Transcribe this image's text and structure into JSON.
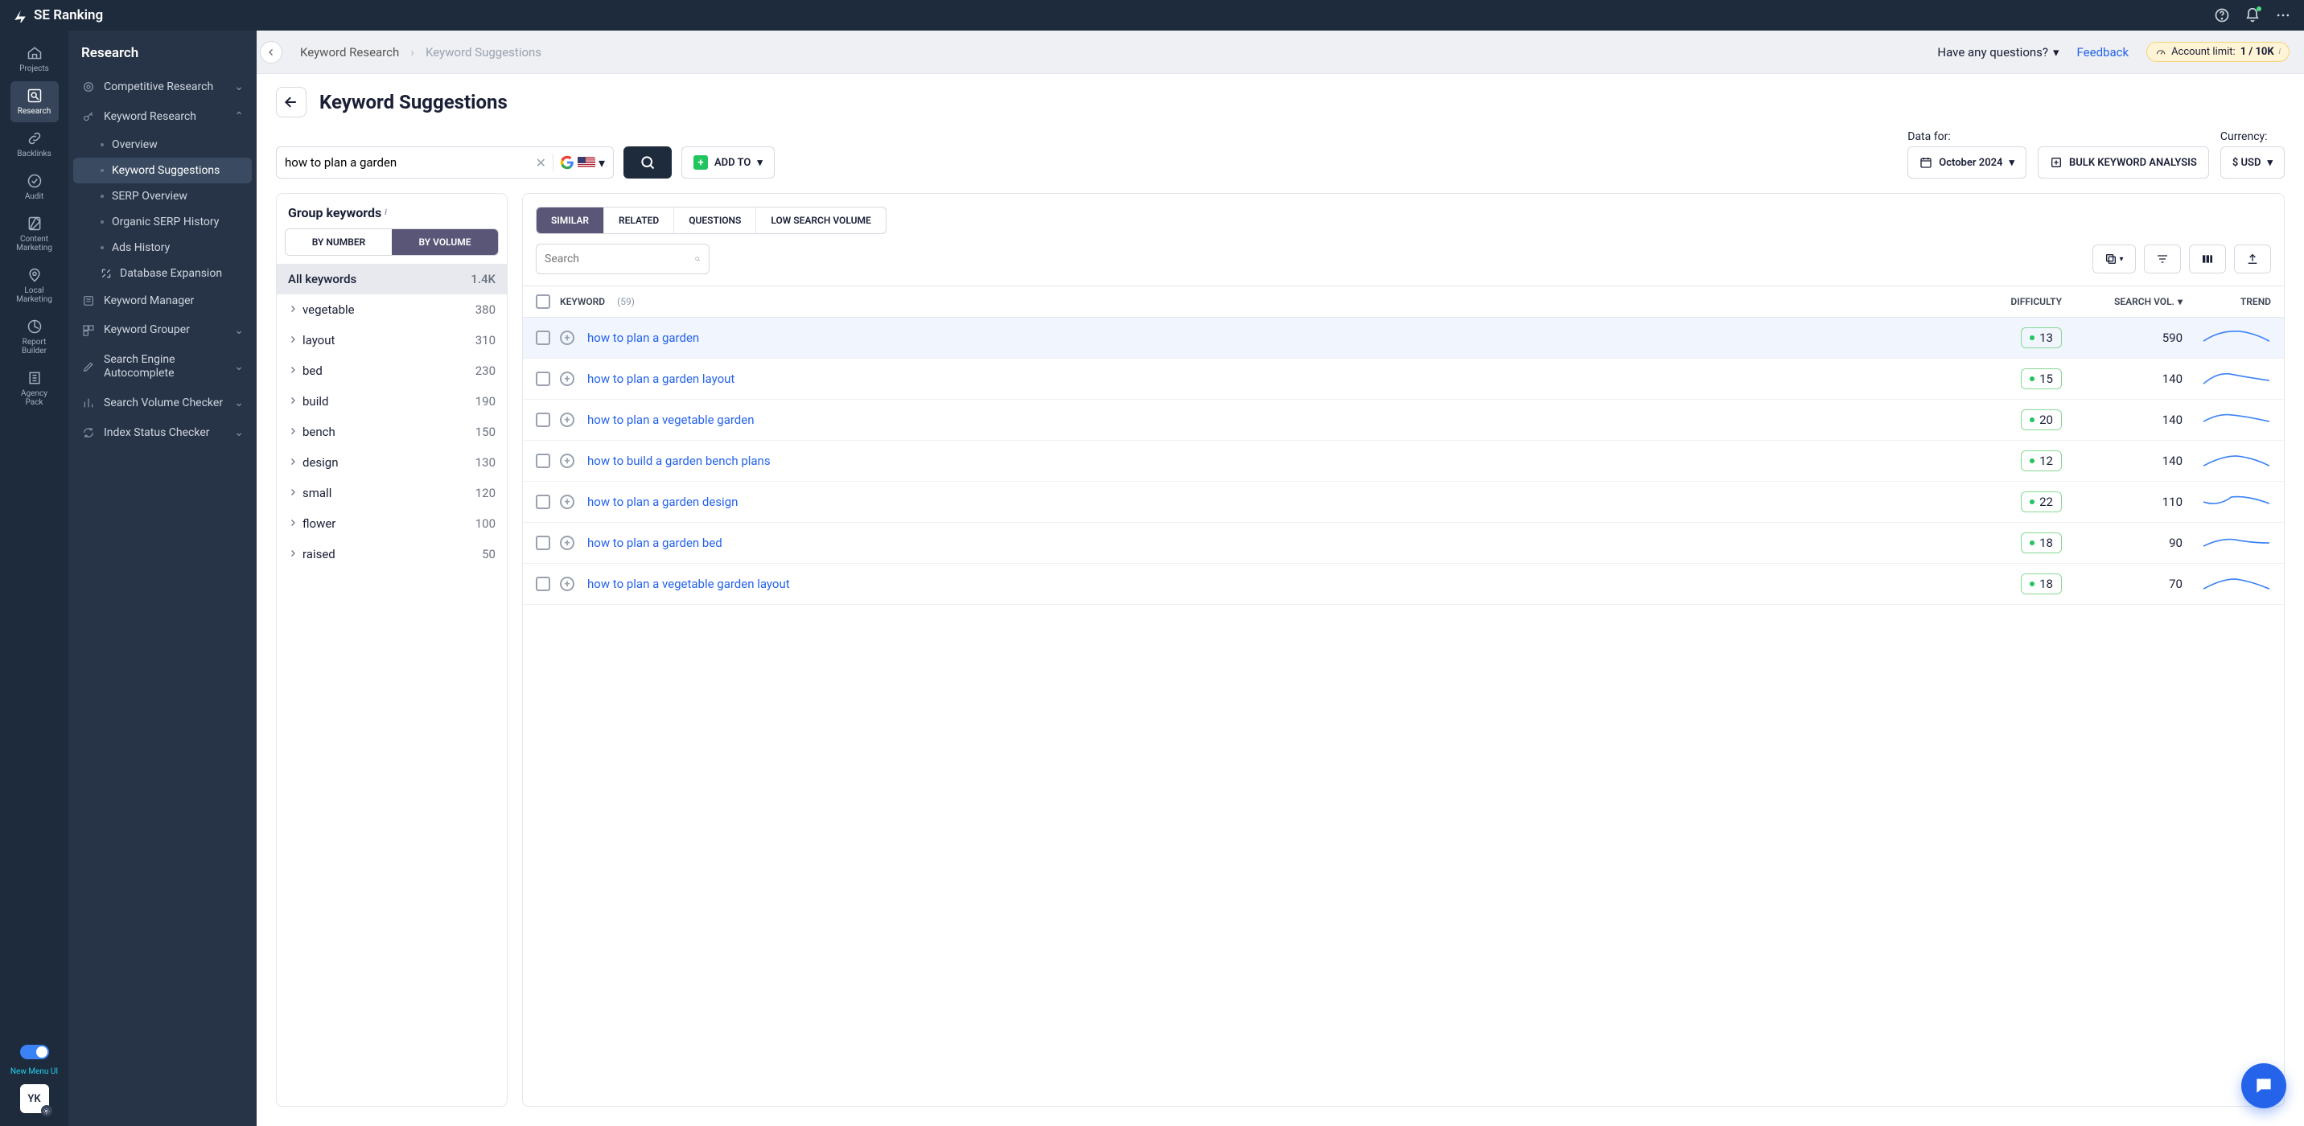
{
  "brand": "SE Ranking",
  "rail": {
    "projects": "Projects",
    "research": "Research",
    "backlinks": "Backlinks",
    "audit": "Audit",
    "content": "Content Marketing",
    "local": "Local Marketing",
    "report": "Report Builder",
    "agency": "Agency Pack"
  },
  "rail_toggle_label": "New Menu UI",
  "avatar": "YK",
  "sidebar": {
    "title": "Research",
    "competitive": "Competitive Research",
    "keyword_research": "Keyword Research",
    "kr_items": {
      "overview": "Overview",
      "suggestions": "Keyword Suggestions",
      "serp_overview": "SERP Overview",
      "organic": "Organic SERP History",
      "ads": "Ads History",
      "db_expansion": "Database Expansion"
    },
    "keyword_manager": "Keyword Manager",
    "keyword_grouper": "Keyword Grouper",
    "autocomplete": "Search Engine Autocomplete",
    "volume_checker": "Search Volume Checker",
    "index_checker": "Index Status Checker"
  },
  "breadcrumb": {
    "a": "Keyword Research",
    "b": "Keyword Suggestions",
    "questions": "Have any questions?",
    "feedback": "Feedback",
    "limit_label": "Account limit:",
    "limit_value": "1 / 10K"
  },
  "page": {
    "title": "Keyword Suggestions",
    "query": "how to plan a garden",
    "add_to": "ADD TO",
    "data_for": "Data for:",
    "date": "October 2024",
    "bulk": "BULK KEYWORD ANALYSIS",
    "currency_label": "Currency:",
    "currency": "$ USD"
  },
  "groups": {
    "title": "Group keywords",
    "by_number": "BY NUMBER",
    "by_volume": "BY VOLUME",
    "all_label": "All keywords",
    "all_value": "1.4K",
    "items": [
      {
        "name": "vegetable",
        "value": "380"
      },
      {
        "name": "layout",
        "value": "310"
      },
      {
        "name": "bed",
        "value": "230"
      },
      {
        "name": "build",
        "value": "190"
      },
      {
        "name": "bench",
        "value": "150"
      },
      {
        "name": "design",
        "value": "130"
      },
      {
        "name": "small",
        "value": "120"
      },
      {
        "name": "flower",
        "value": "100"
      },
      {
        "name": "raised",
        "value": "50"
      }
    ]
  },
  "tabs": {
    "similar": "SIMILAR",
    "related": "RELATED",
    "questions": "QUESTIONS",
    "low": "LOW SEARCH VOLUME"
  },
  "table": {
    "search_placeholder": "Search",
    "h_keyword": "KEYWORD",
    "h_count": "(59)",
    "h_diff": "DIFFICULTY",
    "h_vol": "SEARCH VOL.",
    "h_trend": "TREND",
    "rows": [
      {
        "kw": "how to plan a garden",
        "diff": "13",
        "vol": "590"
      },
      {
        "kw": "how to plan a garden layout",
        "diff": "15",
        "vol": "140"
      },
      {
        "kw": "how to plan a vegetable garden",
        "diff": "20",
        "vol": "140"
      },
      {
        "kw": "how to build a garden bench plans",
        "diff": "12",
        "vol": "140"
      },
      {
        "kw": "how to plan a garden design",
        "diff": "22",
        "vol": "110"
      },
      {
        "kw": "how to plan a garden bed",
        "diff": "18",
        "vol": "90"
      },
      {
        "kw": "how to plan a vegetable garden layout",
        "diff": "18",
        "vol": "70"
      }
    ]
  }
}
